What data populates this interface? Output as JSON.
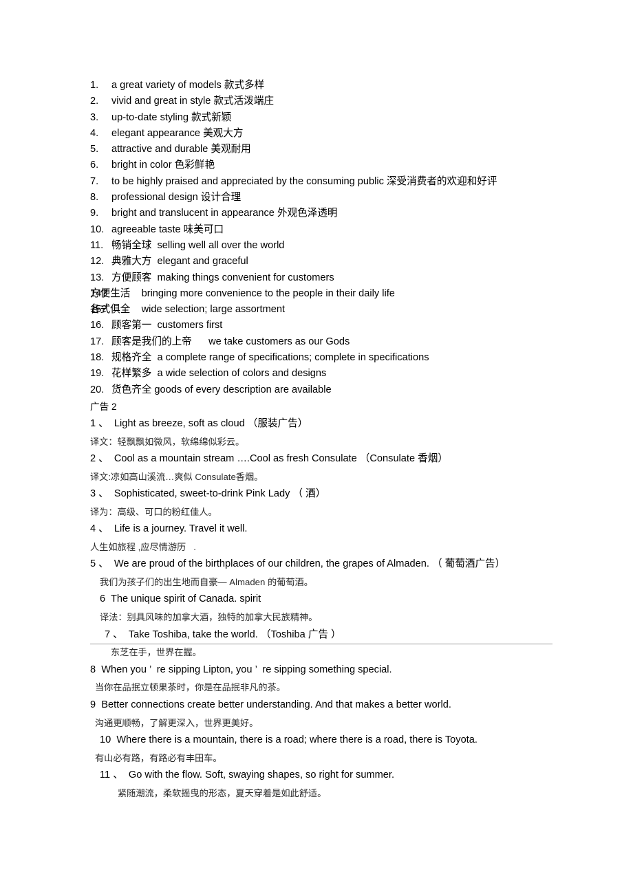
{
  "document": {
    "vocabulary_list": [
      {
        "num": "1.",
        "text": "a great variety of models 款式多样"
      },
      {
        "num": "2.",
        "text": "vivid and great in style 款式活泼端庄"
      },
      {
        "num": "3.",
        "text": "up-to-date styling 款式新颖"
      },
      {
        "num": "4.",
        "text": "elegant appearance 美观大方"
      },
      {
        "num": "5.",
        "text": "attractive and durable 美观耐用"
      },
      {
        "num": "6.",
        "text": "bright in color 色彩鲜艳"
      },
      {
        "num": "7.",
        "text": "to be highly praised and appreciated by the consuming public 深受消费者的欢迎和好评"
      },
      {
        "num": "8.",
        "text": "professional design 设计合理"
      },
      {
        "num": "9.",
        "text": "bright and translucent in appearance 外观色泽透明"
      },
      {
        "num": "10.",
        "text": "agreeable taste 味美可口"
      },
      {
        "num": "11.",
        "text": "畅销全球  selling well all over the world"
      },
      {
        "num": "12.",
        "text": "典雅大方  elegant and graceful"
      },
      {
        "num": "13.",
        "text": "方便顾客  making things convenient for customers"
      },
      {
        "num": "14?",
        "text": "方便生活    bringing more convenience to the people in their daily life",
        "tight": true
      },
      {
        "num": "15?",
        "text": "各式俱全    wide selection; large assortment",
        "tight": true
      },
      {
        "num": "16.",
        "text": "顾客第一  customers first"
      },
      {
        "num": "17.",
        "text": "顾客是我们的上帝      we take customers as our Gods"
      },
      {
        "num": "18.",
        "text": "规格齐全  a complete range of specifications; complete in specifications"
      },
      {
        "num": "19.",
        "text": "花样繁多  a wide selection of colors and designs"
      },
      {
        "num": "20.",
        "text": "货色齐全 goods of every description are available"
      }
    ],
    "ads_section": {
      "heading": "广告 2",
      "items": [
        {
          "kind": "en",
          "indent": 0,
          "text": "1 、  Light as breeze, soft as cloud （服装广告）"
        },
        {
          "kind": "cn",
          "indent": 0,
          "text": "译文：轻飘飘如微风，软绵绵似彩云。"
        },
        {
          "kind": "en",
          "indent": 0,
          "text": "2 、  Cool as a mountain stream ….Cool as fresh Consulate （Consulate 香烟）"
        },
        {
          "kind": "cn",
          "indent": 0,
          "text": "译文:凉如高山溪流…爽似 Consulate香烟。"
        },
        {
          "kind": "en",
          "indent": 0,
          "text": "3 、  Sophisticated, sweet-to-drink Pink Lady （ 酒）"
        },
        {
          "kind": "cn",
          "indent": 0,
          "text": "译为：高级、可口的粉红佳人。"
        },
        {
          "kind": "en",
          "indent": 0,
          "text": "4 、  Life is a journey. Travel it well."
        },
        {
          "kind": "cn",
          "indent": 0,
          "text": "人生如旅程 ,应尽情游历   ."
        },
        {
          "kind": "en",
          "indent": 0,
          "text": "5 、  We are proud of the birthplaces of our children, the grapes of Almaden. （ 葡萄酒广告）"
        },
        {
          "kind": "cn",
          "indent": 2,
          "text": "我们为孩子们的出生地而自豪— Almaden 的葡萄酒。"
        },
        {
          "kind": "en",
          "indent": 2,
          "text": "6  The unique spirit of Canada. spirit"
        },
        {
          "kind": "cn",
          "indent": 2,
          "text": "译法：别具风味的加拿大酒，独特的加拿大民族精神。"
        },
        {
          "kind": "en",
          "indent": 3,
          "text": "7 、  Take Toshiba, take the world. （Toshiba 广告 ）"
        },
        {
          "kind": "cn",
          "indent": 4,
          "text": "东芝在手，世界在握。"
        },
        {
          "kind": "en",
          "indent": 0,
          "text": "8  When you ’  re sipping Lipton, you ’  re sipping something special."
        },
        {
          "kind": "cn",
          "indent": 1,
          "text": "当你在品抿立顿果茶时，你是在品抿非凡的茶。"
        },
        {
          "kind": "en",
          "indent": 0,
          "text": "9  Better connections create better understanding. And that makes a better world."
        },
        {
          "kind": "cn",
          "indent": 1,
          "text": "沟通更顺畅，了解更深入，世界更美好。"
        },
        {
          "kind": "en",
          "indent": 2,
          "text": "10  Where there is a mountain, there is a road; where there is a road, there is Toyota."
        },
        {
          "kind": "cn",
          "indent": 1,
          "text": "有山必有路，有路必有丰田车。"
        },
        {
          "kind": "en",
          "indent": 2,
          "text": "11 、  Go with the flow. Soft, swaying shapes, so right for summer."
        },
        {
          "kind": "cn",
          "indent": 5,
          "text": "紧随潮流，柔软摇曳的形态，夏天穿着是如此舒适。"
        }
      ]
    }
  }
}
